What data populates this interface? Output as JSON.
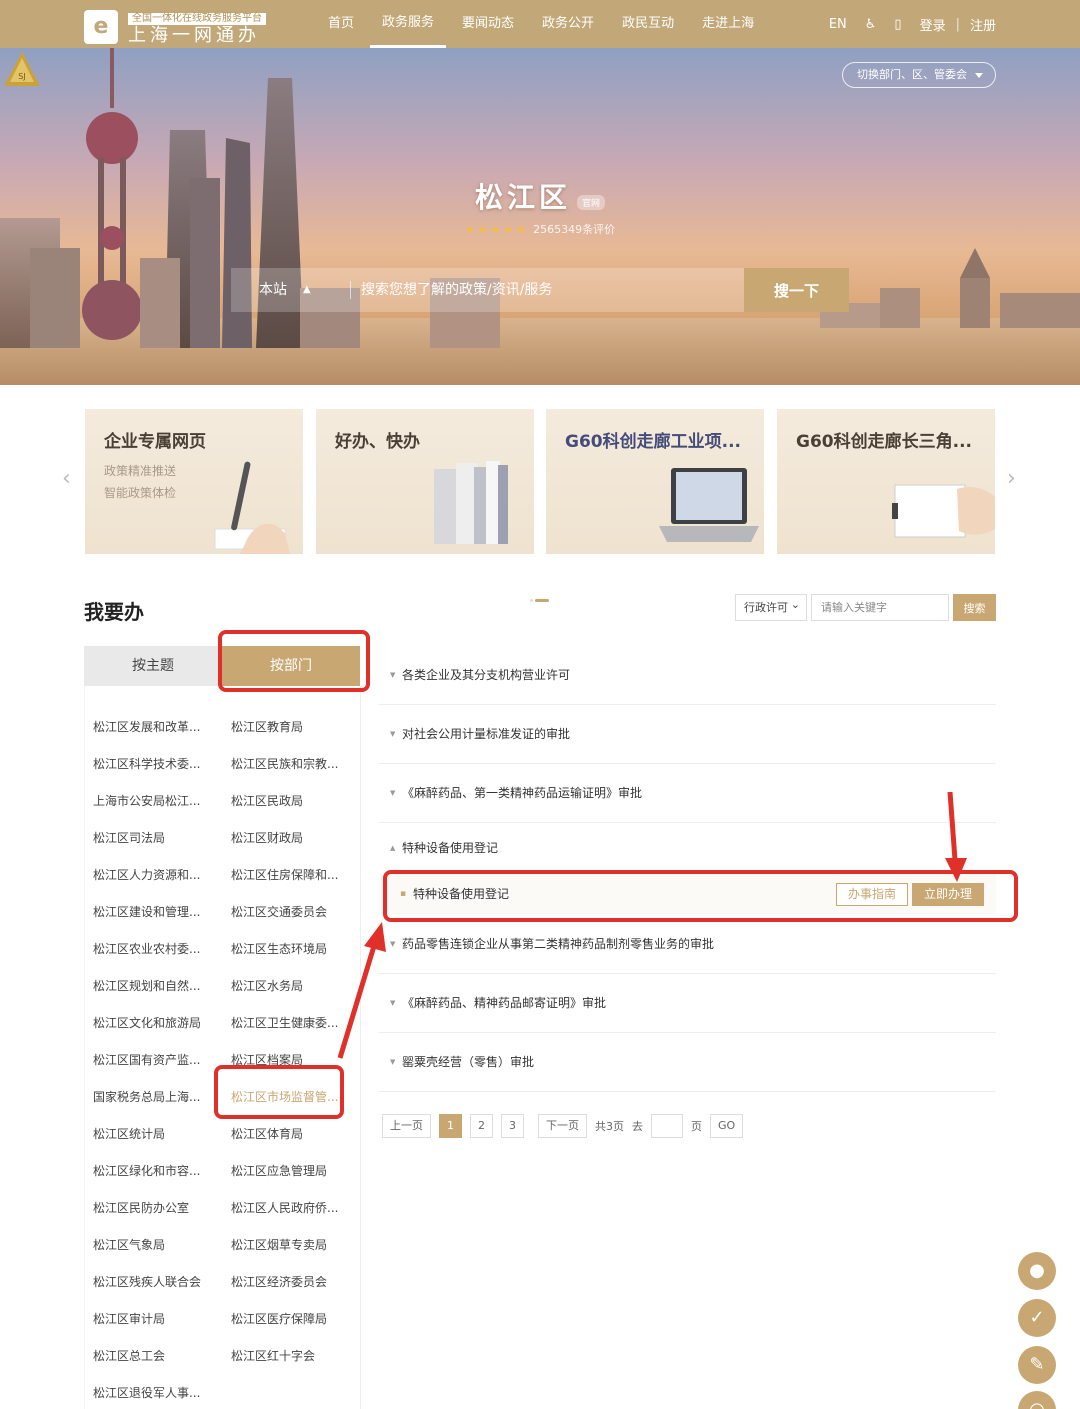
{
  "header": {
    "logo_sub": "全国一体化在线政务服务平台",
    "logo_main": "上海一网通办",
    "nav": [
      "首页",
      "政务服务",
      "要闻动态",
      "政务公开",
      "政民互动",
      "走进上海"
    ],
    "active_nav": "政务服务",
    "lang": "EN",
    "login": "登录",
    "register": "注册"
  },
  "hero": {
    "switch_label": "切换部门、区、管委会",
    "emblem_text": "SJ",
    "district_name": "松江区",
    "official_badge": "官网",
    "rating_text": "2565349条评价",
    "search_scope": "本站",
    "search_placeholder": "搜索您想了解的政策/资讯/服务",
    "search_button": "搜一下"
  },
  "cards": [
    {
      "title": "企业专属网页",
      "line1": "政策精准推送",
      "line2": "智能政策体检"
    },
    {
      "title": "好办、快办"
    },
    {
      "title": "G60科创走廊工业项..."
    },
    {
      "title": "G60科创走廊长三角..."
    }
  ],
  "section": {
    "title": "我要办",
    "filter_select": "行政许可",
    "filter_placeholder": "请输入关键字",
    "filter_button": "搜索",
    "tab_theme": "按主题",
    "tab_dept": "按部门"
  },
  "departments": [
    "松江区发展和改革...",
    "松江区教育局",
    "松江区科学技术委...",
    "松江区民族和宗教...",
    "上海市公安局松江...",
    "松江区民政局",
    "松江区司法局",
    "松江区财政局",
    "松江区人力资源和...",
    "松江区住房保障和...",
    "松江区建设和管理...",
    "松江区交通委员会",
    "松江区农业农村委...",
    "松江区生态环境局",
    "松江区规划和自然...",
    "松江区水务局",
    "松江区文化和旅游局",
    "松江区卫生健康委...",
    "松江区国有资产监...",
    "松江区档案局",
    "国家税务总局上海...",
    "松江区市场监督管...",
    "松江区统计局",
    "松江区体育局",
    "松江区绿化和市容...",
    "松江区应急管理局",
    "松江区民防办公室",
    "松江区人民政府侨...",
    "松江区气象局",
    "松江区烟草专卖局",
    "松江区残疾人联合会",
    "松江区经济委员会",
    "松江区审计局",
    "松江区医疗保障局",
    "松江区总工会",
    "松江区红十字会",
    "松江区退役军人事..."
  ],
  "highlighted_department": "松江区市场监督管...",
  "items": [
    {
      "title": "各类企业及其分支机构营业许可",
      "expanded": false
    },
    {
      "title": "对社会公用计量标准发证的审批",
      "expanded": false
    },
    {
      "title": "《麻醉药品、第一类精神药品运输证明》审批",
      "expanded": false
    },
    {
      "title": "特种设备使用登记",
      "expanded": true
    },
    {
      "title": "药品零售连锁企业从事第二类精神药品制剂零售业务的审批",
      "expanded": false
    },
    {
      "title": "《麻醉药品、精神药品邮寄证明》审批",
      "expanded": false
    },
    {
      "title": "罂粟壳经营（零售）审批",
      "expanded": false
    }
  ],
  "sub_item": {
    "title": "特种设备使用登记",
    "guide_label": "办事指南",
    "do_label": "立即办理"
  },
  "pager": {
    "prev": "上一页",
    "pages": [
      "1",
      "2",
      "3"
    ],
    "current": "1",
    "next": "下一页",
    "total": "共3页",
    "goto": "去",
    "page_unit": "页",
    "go": "GO"
  },
  "colors": {
    "gold": "#c8a772",
    "nav": "#c2a878",
    "annotation": "#e0302a"
  }
}
